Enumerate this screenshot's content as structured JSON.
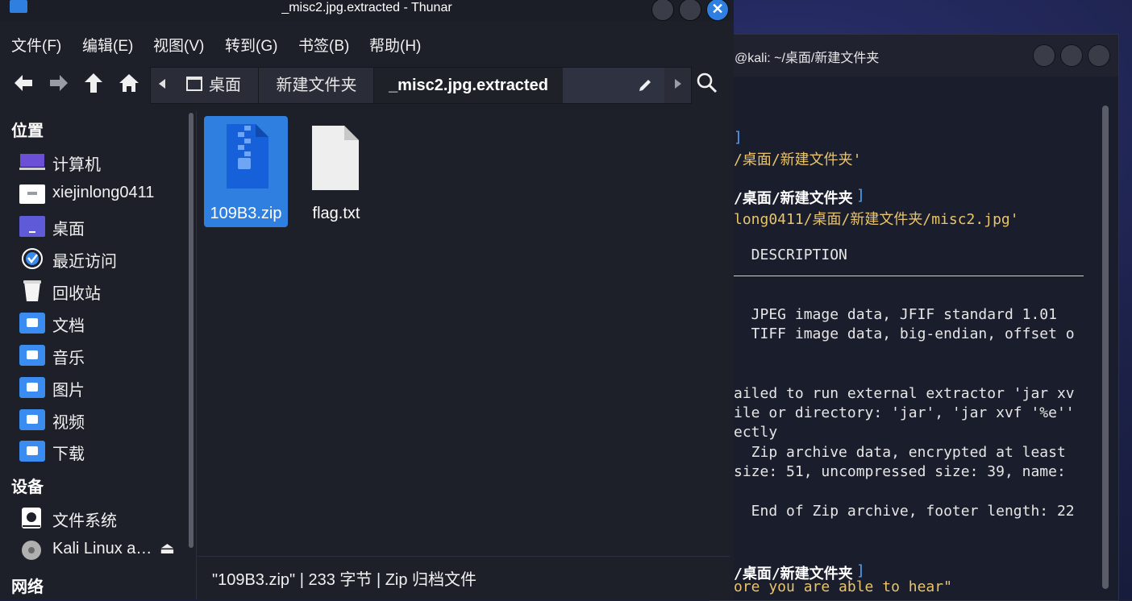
{
  "window": {
    "title": "_misc2.jpg.extracted - Thunar",
    "close_glyph": "✕"
  },
  "menu": [
    "文件(F)",
    "编辑(E)",
    "视图(V)",
    "转到(G)",
    "书签(B)",
    "帮助(H)"
  ],
  "pathbar": {
    "crumbs": [
      "桌面",
      "新建文件夹",
      "_misc2.jpg.extracted"
    ],
    "edit_icon": "pencil-icon"
  },
  "sidebar": {
    "sections": {
      "places": "位置",
      "devices": "设备",
      "network": "网络"
    },
    "places": [
      {
        "label": "计算机",
        "icon": "computer-icon"
      },
      {
        "label": "xiejinlong0411",
        "icon": "home-icon"
      },
      {
        "label": "桌面",
        "icon": "desktop-icon"
      },
      {
        "label": "最近访问",
        "icon": "recent-icon"
      },
      {
        "label": "回收站",
        "icon": "trash-icon"
      },
      {
        "label": "文档",
        "icon": "documents-icon"
      },
      {
        "label": "音乐",
        "icon": "music-icon"
      },
      {
        "label": "图片",
        "icon": "pictures-icon"
      },
      {
        "label": "视频",
        "icon": "videos-icon"
      },
      {
        "label": "下载",
        "icon": "downloads-icon"
      }
    ],
    "devices": [
      {
        "label": "文件系统",
        "icon": "drive-icon"
      },
      {
        "label": "Kali Linux a…",
        "icon": "disc-icon",
        "eject": "⏏"
      }
    ]
  },
  "files": [
    {
      "name": "109B3.zip",
      "icon": "zip-icon",
      "selected": true
    },
    {
      "name": "flag.txt",
      "icon": "text-file-icon",
      "selected": false
    }
  ],
  "status": "\"109B3.zip\" | 233 字节 | Zip 归档文件",
  "terminal": {
    "title": "@kali: ~/桌面/新建文件夹",
    "lines": [
      {
        "text": "]",
        "cls": "t-bracket"
      },
      {
        "text": "/桌面/新建文件夹'",
        "cls": "t-yellow"
      },
      {
        "text": "/桌面/新建文件夹",
        "cls": "t-bold",
        "suffix": "]"
      },
      {
        "text": "long0411/桌面/新建文件夹/misc2.jpg'",
        "cls": "t-yellow"
      },
      {
        "text": "  DESCRIPTION",
        "cls": ""
      },
      {
        "text": "  JPEG image data, JFIF standard 1.01",
        "cls": ""
      },
      {
        "text": "  TIFF image data, big-endian, offset o",
        "cls": ""
      },
      {
        "text": "ailed to run external extractor 'jar xv",
        "cls": ""
      },
      {
        "text": "ile or directory: 'jar', 'jar xvf '%e''",
        "cls": ""
      },
      {
        "text": "ectly",
        "cls": ""
      },
      {
        "text": "  Zip archive data, encrypted at least",
        "cls": ""
      },
      {
        "text": "size: 51, uncompressed size: 39, name:",
        "cls": ""
      },
      {
        "text": "  End of Zip archive, footer length: 22",
        "cls": ""
      },
      {
        "text": "/桌面/新建文件夹",
        "cls": "t-bold",
        "suffix": "]"
      },
      {
        "text": "ore you are able to hear\"",
        "cls": "t-yellow"
      }
    ]
  },
  "colors": {
    "accent": "#2f7fe0",
    "terminal_yellow": "#e9c46a"
  }
}
